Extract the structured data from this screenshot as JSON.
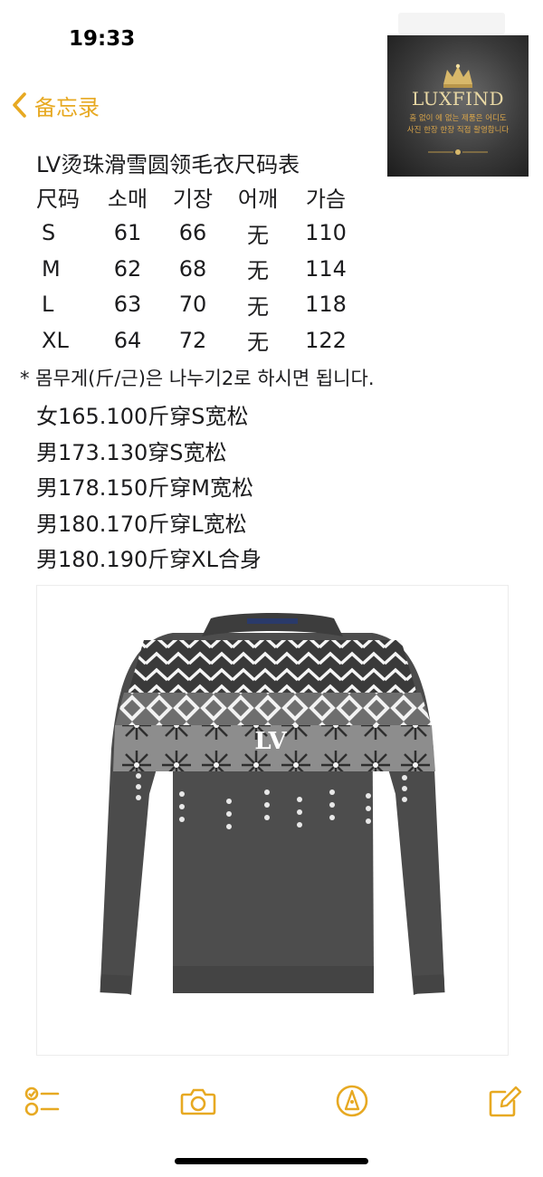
{
  "status_bar": {
    "time": "19:33"
  },
  "nav": {
    "back_label": "备忘录"
  },
  "logo": {
    "brand": "LUXFIND",
    "tagline_1": "흠 없이 에 없는 제품은 어디도",
    "tagline_2": "사진 한장 한장 직접 촬영합니다"
  },
  "note": {
    "title": "LV烫珠滑雪圆领毛衣尺码表",
    "table": {
      "headers": [
        "尺码",
        "소매",
        "기장",
        "어깨",
        "가슴"
      ],
      "rows": [
        [
          "S",
          "61",
          "66",
          "无",
          "110"
        ],
        [
          "M",
          "62",
          "68",
          "无",
          "114"
        ],
        [
          "L",
          "63",
          "70",
          "无",
          "118"
        ],
        [
          "XL",
          "64",
          "72",
          "无",
          "122"
        ]
      ]
    },
    "weight_note": "* 몸무게(斤/근)은 나누기2로 하시면 됩니다.",
    "fit_lines": [
      "女165.100斤穿S宽松",
      "男173.130穿S宽松",
      "男178.150斤穿M宽松",
      "男180.170斤穿L宽松",
      "男180.190斤穿XL合身"
    ],
    "photo": {
      "alt": "LV sweater",
      "collar_label": "LOUIS VUITTON"
    }
  },
  "toolbar": {
    "checklist_icon": "checklist-icon",
    "camera_icon": "camera-icon",
    "markup_icon": "pen-markup-icon",
    "compose_icon": "compose-icon"
  },
  "colors": {
    "accent": "#E7A922",
    "text": "#1c1c1e",
    "sweater": "#4a4a4a"
  }
}
